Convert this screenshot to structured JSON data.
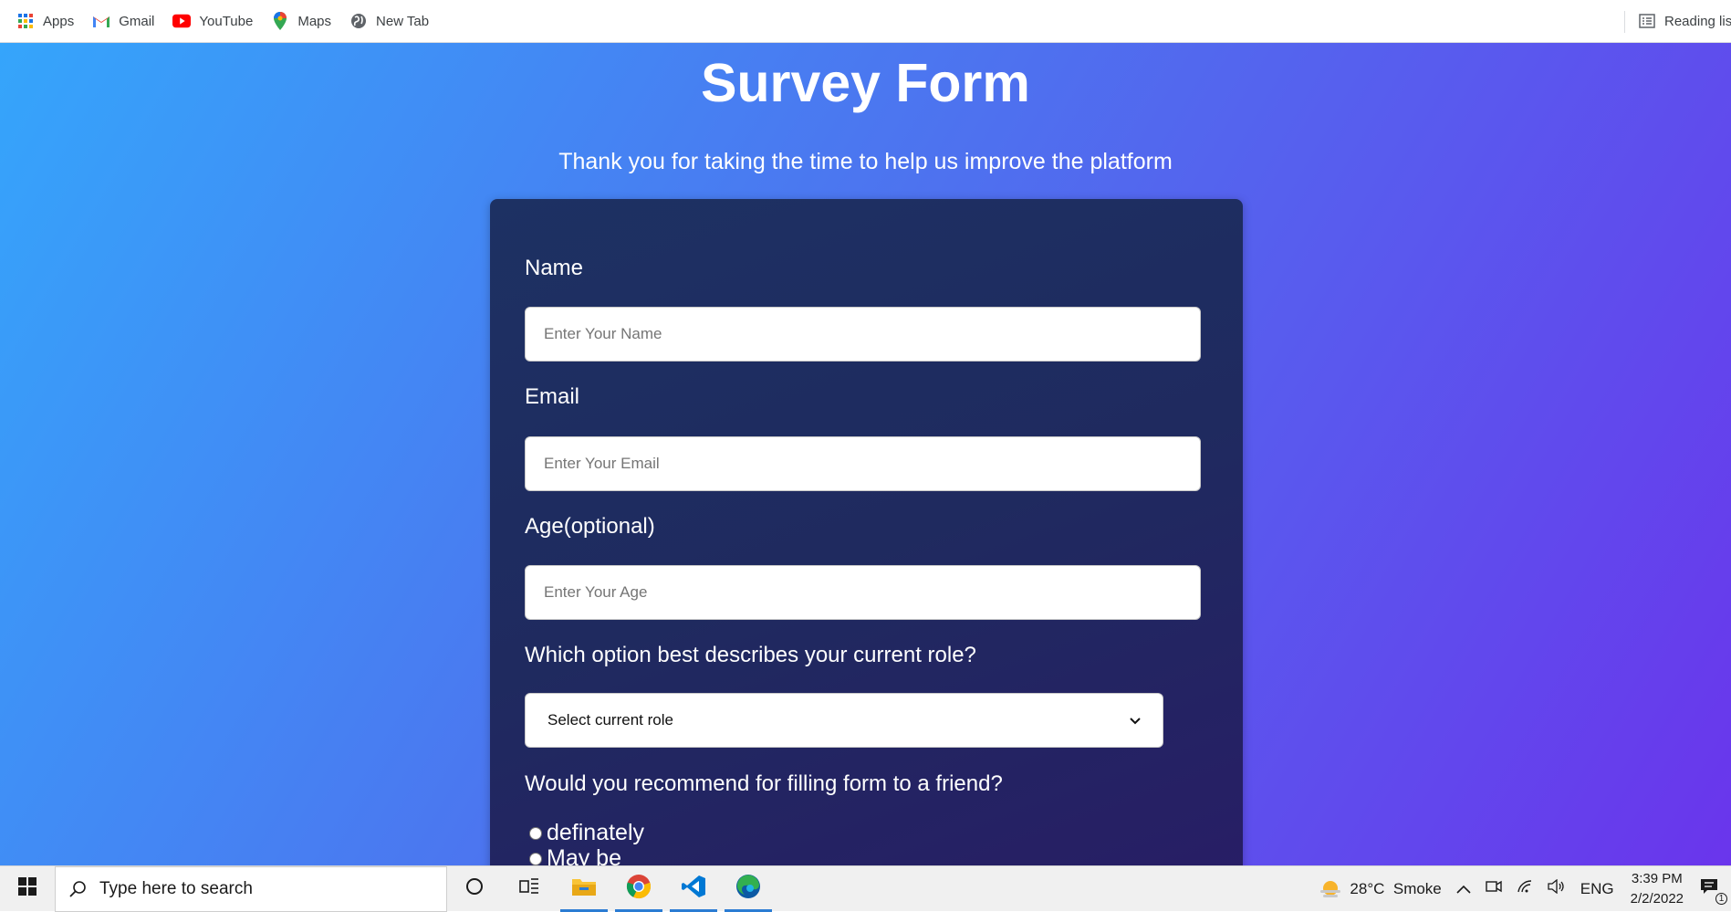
{
  "bookmarks": {
    "items": [
      {
        "label": "Apps",
        "icon": "apps-grid-icon"
      },
      {
        "label": "Gmail",
        "icon": "gmail-icon"
      },
      {
        "label": "YouTube",
        "icon": "youtube-icon"
      },
      {
        "label": "Maps",
        "icon": "maps-icon"
      },
      {
        "label": "New Tab",
        "icon": "globe-icon"
      }
    ],
    "reading_list": "Reading list"
  },
  "page": {
    "title": "Survey Form",
    "subtitle": "Thank you for taking the time to help us improve the platform",
    "form": {
      "name_label": "Name",
      "name_placeholder": "Enter Your Name",
      "email_label": "Email",
      "email_placeholder": "Enter Your Email",
      "age_label": "Age(optional)",
      "age_placeholder": "Enter Your Age",
      "role_label": "Which option best describes your current role?",
      "role_selected": "Select current role",
      "recommend_label": "Would you recommend for filling form to a friend?",
      "recommend_options": [
        "definately",
        "May be"
      ]
    },
    "colors": {
      "gradient_start": "#35a5fb",
      "gradient_end": "#6a35ec",
      "card": "#1f2a5f"
    }
  },
  "taskbar": {
    "search_placeholder": "Type here to search",
    "apps": [
      "file-explorer-icon",
      "chrome-icon",
      "vscode-icon",
      "edge-icon"
    ],
    "weather": "28°C  Smoke",
    "language": "ENG",
    "time": "3:39 PM",
    "date": "2/2/2022",
    "notification_count": "1"
  }
}
